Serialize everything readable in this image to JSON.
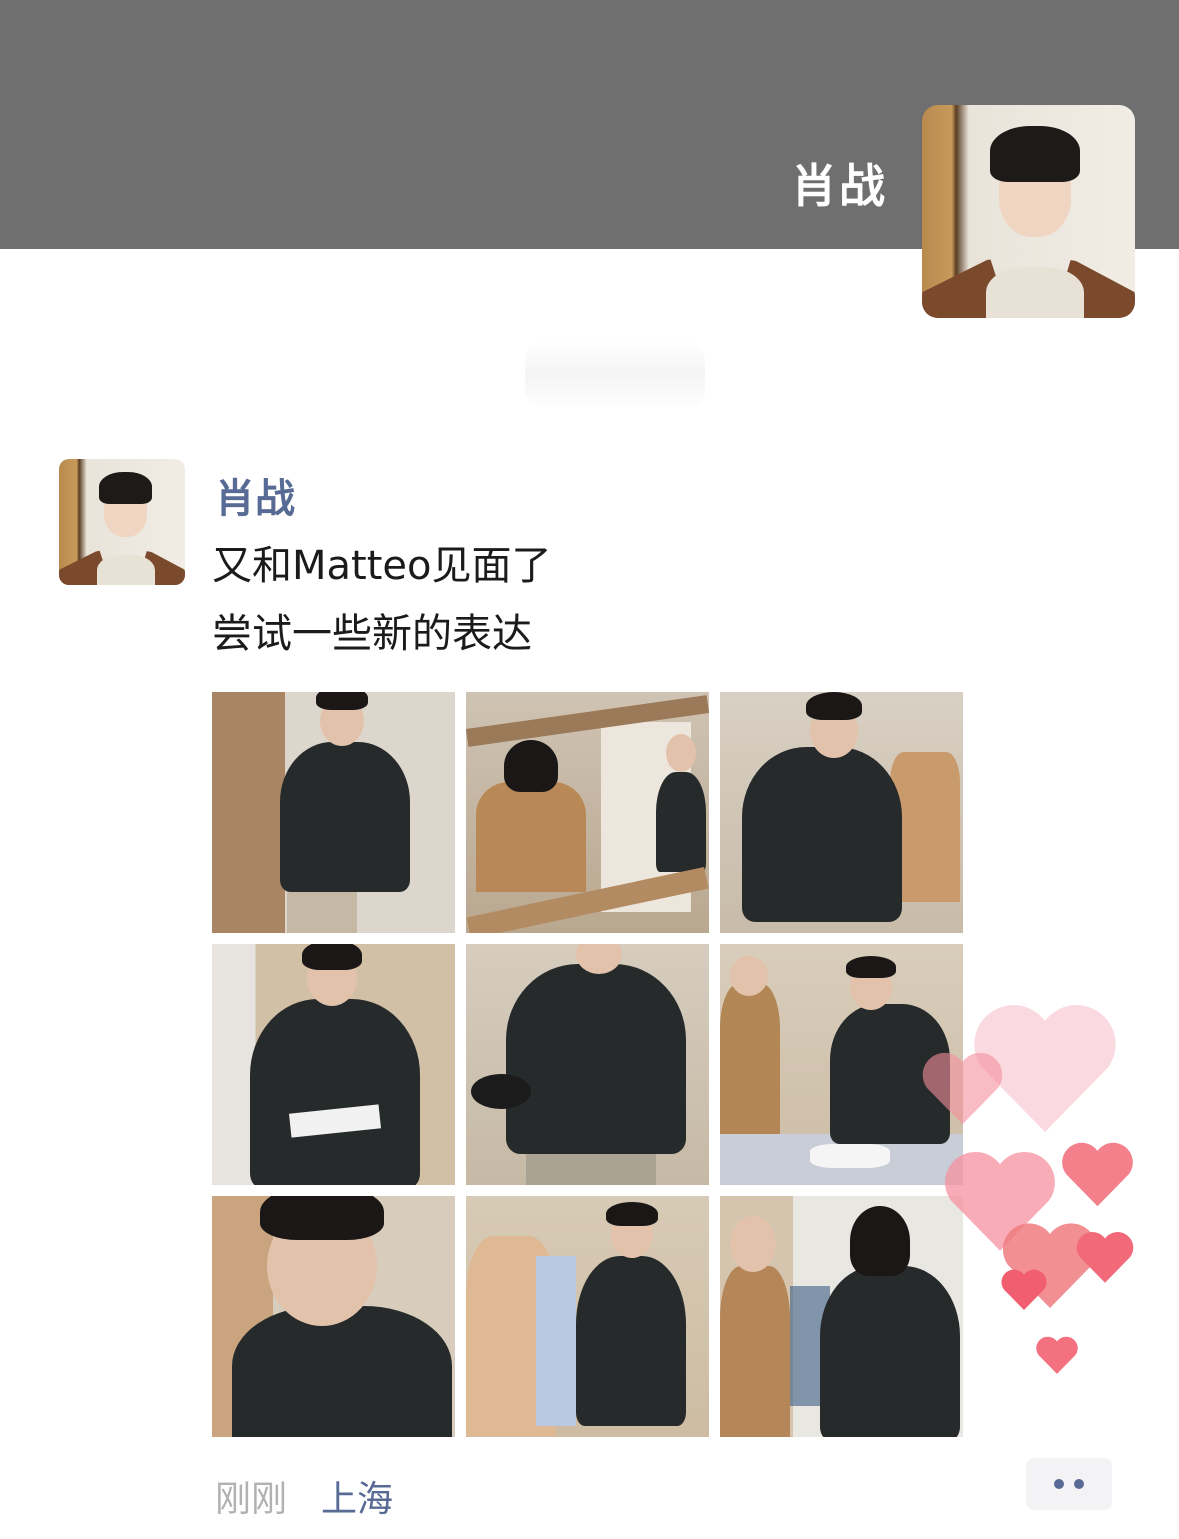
{
  "cover": {
    "user_name": "肖战"
  },
  "post": {
    "author": "肖战",
    "text_lines": [
      "又和Matteo见面了",
      "尝试一些新的表达"
    ],
    "photos": [
      {
        "name": "photo-1"
      },
      {
        "name": "photo-2"
      },
      {
        "name": "photo-3"
      },
      {
        "name": "photo-4"
      },
      {
        "name": "photo-5"
      },
      {
        "name": "photo-6"
      },
      {
        "name": "photo-7"
      },
      {
        "name": "photo-8"
      },
      {
        "name": "photo-9"
      }
    ],
    "time": "刚刚",
    "location": "上海",
    "more_icon": "more-dots-icon"
  },
  "colors": {
    "cover_bg": "#6f6f6f",
    "link_blue": "#576b95",
    "time_gray": "#b2b2b2",
    "heart_pink": "#f2697a"
  }
}
